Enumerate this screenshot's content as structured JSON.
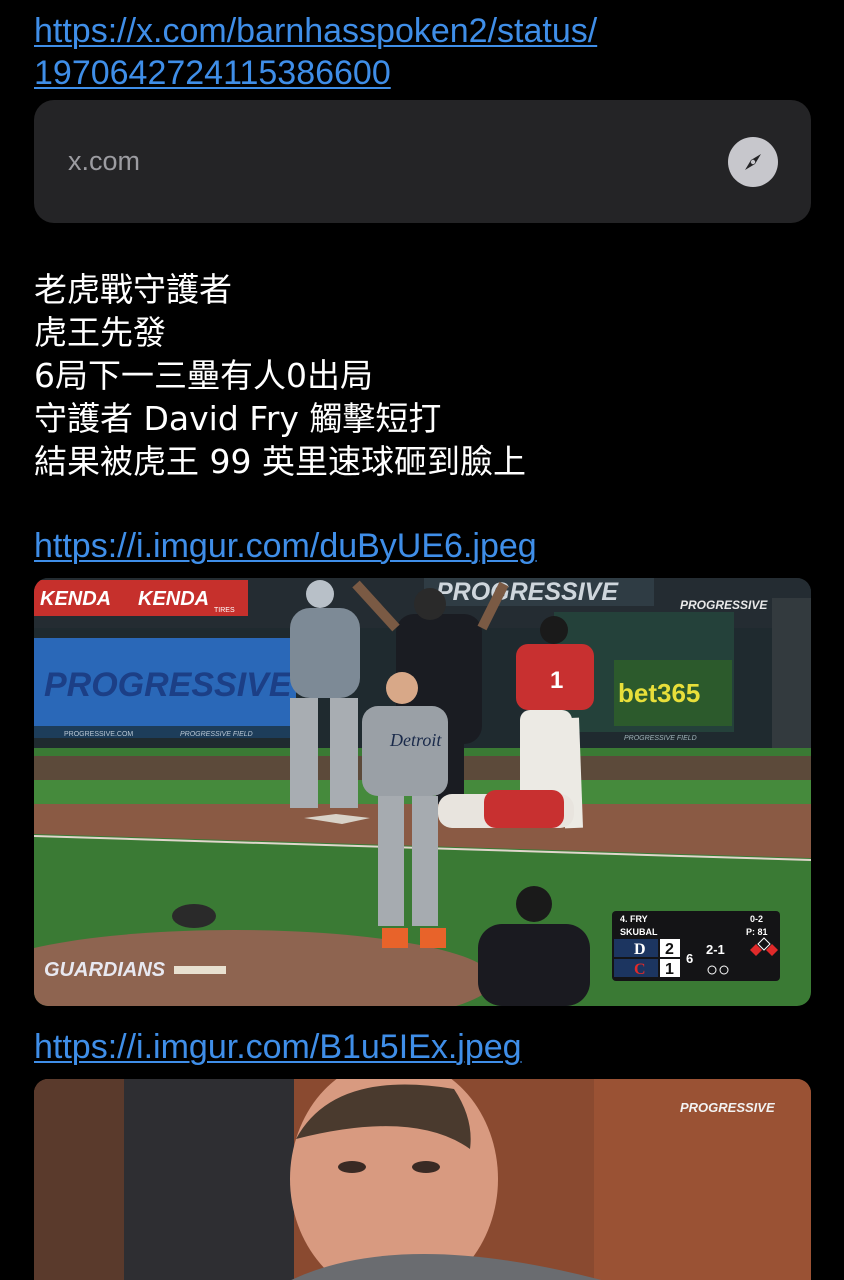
{
  "tweet_link": {
    "line1": "https://x.com/barnhasspoken2/status/",
    "line2": "1970642724115386600"
  },
  "preview": {
    "domain": "x.com",
    "icon": "compass-icon"
  },
  "message": {
    "lines": [
      "老虎戰守護者",
      "虎王先發",
      "6局下一三壘有人0出局",
      "守護者 David Fry 觸擊短打",
      "結果被虎王 99 英里速球砸到臉上"
    ]
  },
  "image_links": [
    "https://i.imgur.com/duByUE6.jpeg",
    "https://i.imgur.com/B1u5IEx.jpeg"
  ],
  "photo1": {
    "ads": {
      "kenda": "KENDA",
      "kenda_sub": "TIRES",
      "progressive": "PROGRESSIVE",
      "progressive_com": "PROGRESSIVE.COM",
      "progressive_field": "PROGRESSIVE FIELD",
      "bet365": "bet365",
      "mound": "GUARDIANS"
    },
    "jerseys": {
      "runner_number": "1",
      "pitcher_team": "Detroit"
    },
    "scorebug": {
      "batter": "4. FRY",
      "count": "0-2",
      "pitcher": "SKUBAL",
      "pitch_count": "P: 81",
      "away_logo": "D",
      "away_score": "2",
      "home_logo": "C",
      "home_score": "1",
      "inning": "6",
      "outs_label": "2-1"
    }
  },
  "photo2": {
    "ad": "PROGRESSIVE"
  },
  "colors": {
    "background": "#000000",
    "link": "#3f8ee8",
    "card": "#242426",
    "text": "#ffffff",
    "domain_text": "#9c9ca1"
  }
}
